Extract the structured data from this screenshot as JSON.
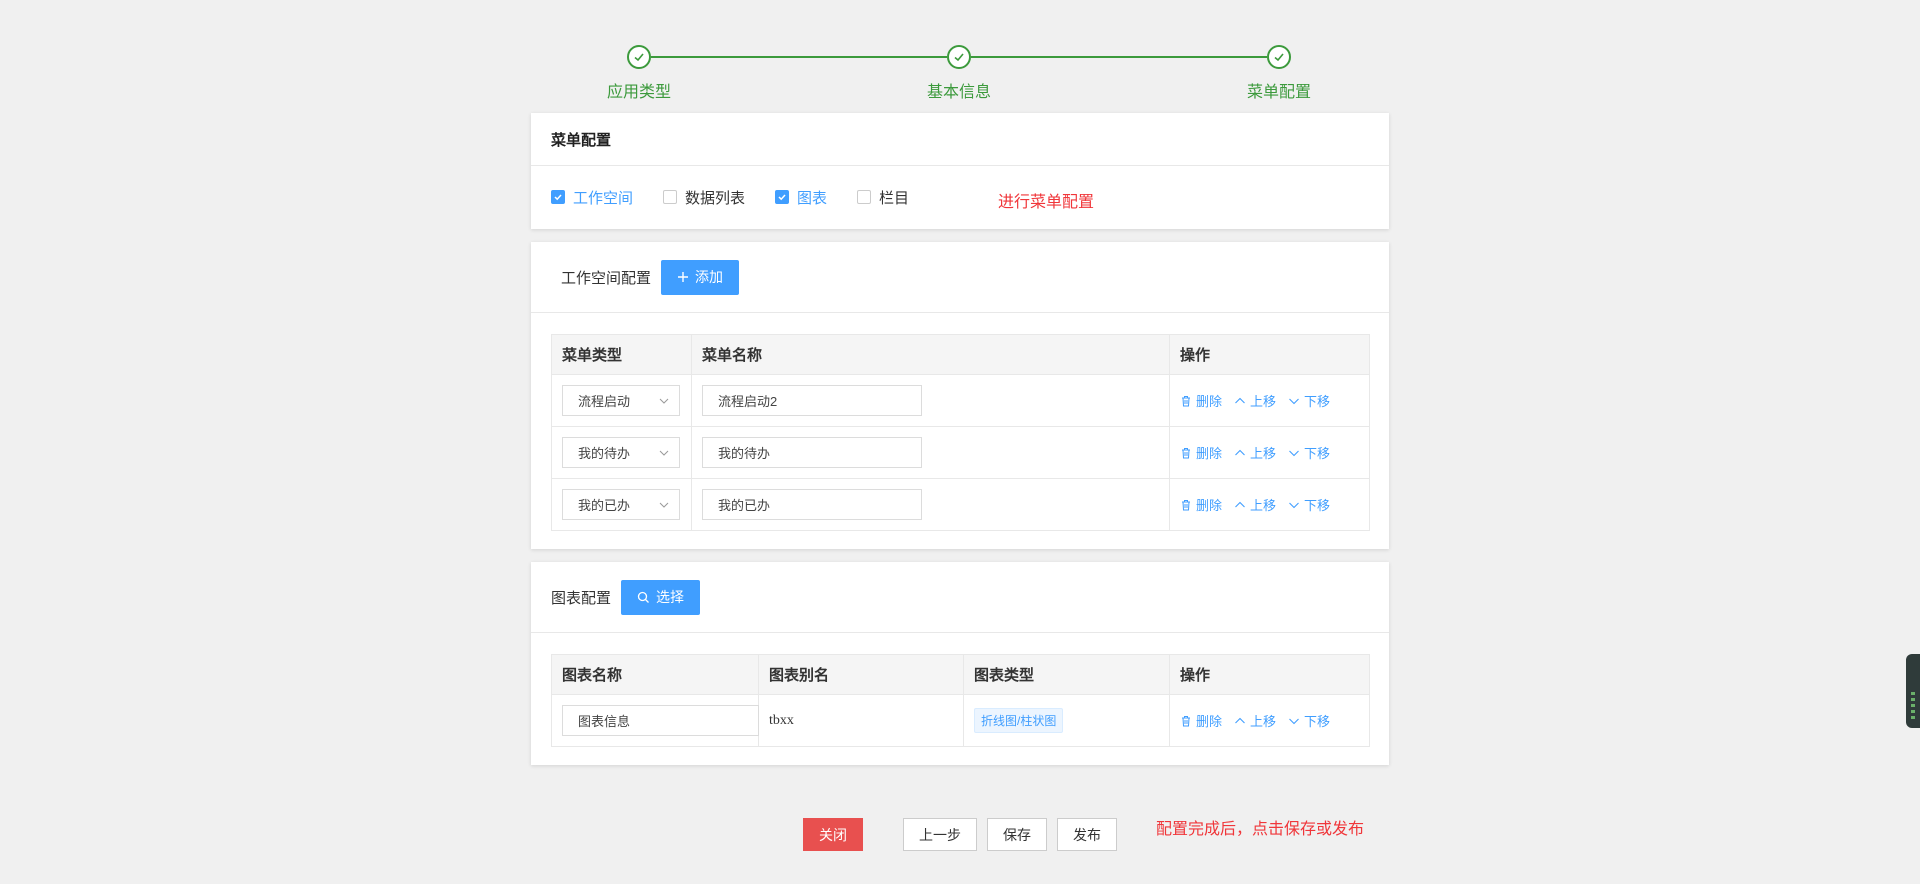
{
  "steps": [
    {
      "label": "应用类型"
    },
    {
      "label": "基本信息"
    },
    {
      "label": "菜单配置"
    }
  ],
  "menu_config": {
    "title": "菜单配置",
    "options": [
      {
        "label": "工作空间",
        "checked": true
      },
      {
        "label": "数据列表",
        "checked": false
      },
      {
        "label": "图表",
        "checked": true
      },
      {
        "label": "栏目",
        "checked": false
      }
    ],
    "hint": "进行菜单配置"
  },
  "workspace": {
    "title": "工作空间配置",
    "add_label": "添加",
    "columns": [
      "菜单类型",
      "菜单名称",
      "操作"
    ],
    "rows": [
      {
        "type": "流程启动",
        "name": "流程启动2"
      },
      {
        "type": "我的待办",
        "name": "我的待办"
      },
      {
        "type": "我的已办",
        "name": "我的已办"
      }
    ]
  },
  "chart_config": {
    "title": "图表配置",
    "select_label": "选择",
    "columns": [
      "图表名称",
      "图表别名",
      "图表类型",
      "操作"
    ],
    "rows": [
      {
        "name": "图表信息",
        "alias": "tbxx",
        "chart_type": "折线图/柱状图"
      }
    ]
  },
  "actions": {
    "delete": "删除",
    "up": "上移",
    "down": "下移"
  },
  "footer": {
    "close": "关闭",
    "prev": "上一步",
    "save": "保存",
    "publish": "发布",
    "hint": "配置完成后，点击保存或发布"
  },
  "colors": {
    "success": "#3c9a3c",
    "primary": "#409eff",
    "danger": "#e8504f",
    "hint": "#f0363a"
  }
}
